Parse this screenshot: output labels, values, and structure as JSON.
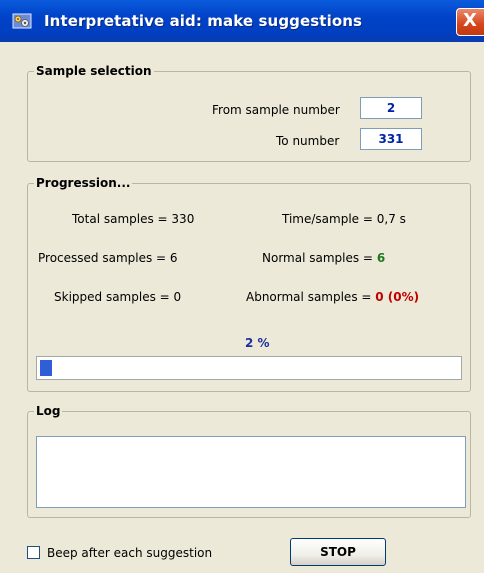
{
  "window": {
    "title": "Interpretative aid: make suggestions",
    "close_label": "X"
  },
  "sample_selection": {
    "legend": "Sample selection",
    "from_label": "From sample number",
    "from_value": "2",
    "to_label": "To number",
    "to_value": "331"
  },
  "progression": {
    "legend": "Progression...",
    "total_label": "Total samples =",
    "total_value": "330",
    "time_label": "Time/sample =",
    "time_value": "0,7 s",
    "processed_label": "Processed samples =",
    "processed_value": "6",
    "normal_label": "Normal samples =",
    "normal_value": "6",
    "skipped_label": "Skipped samples =",
    "skipped_value": "0",
    "abnormal_label": "Abnormal samples =",
    "abnormal_value": "0 (0%)",
    "percent_text": "2 %",
    "progress_fraction": 0.02
  },
  "log": {
    "legend": "Log"
  },
  "footer": {
    "beep_label": "Beep after each suggestion",
    "beep_checked": false,
    "stop_label": "STOP"
  },
  "colors": {
    "title_bar": "#0042c8",
    "progress_fill": "#2f5fd6",
    "normal_value": "#1f7a1f",
    "abnormal_value": "#c00000",
    "input_value": "#0022a8"
  }
}
